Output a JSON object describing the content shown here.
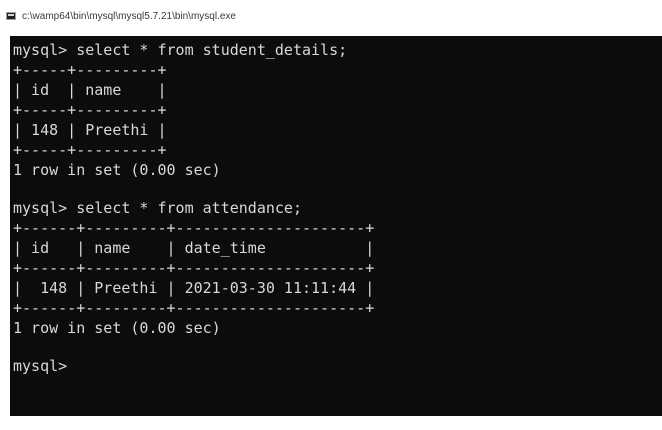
{
  "window": {
    "title": "c:\\wamp64\\bin\\mysql\\mysql5.7.21\\bin\\mysql.exe",
    "icon": "console-window-icon"
  },
  "terminal": {
    "background": "#0c0c0c",
    "foreground": "#d8d8d8",
    "lines": [
      "mysql> select * from student_details;",
      "+-----+---------+",
      "| id  | name    |",
      "+-----+---------+",
      "| 148 | Preethi |",
      "+-----+---------+",
      "1 row in set (0.00 sec)",
      "",
      "mysql> select * from attendance;",
      "+------+---------+---------------------+",
      "| id   | name    | date_time           |",
      "+------+---------+---------------------+",
      "|  148 | Preethi | 2021-03-30 11:11:44 |",
      "+------+---------+---------------------+",
      "1 row in set (0.00 sec)",
      "",
      "mysql>"
    ]
  }
}
